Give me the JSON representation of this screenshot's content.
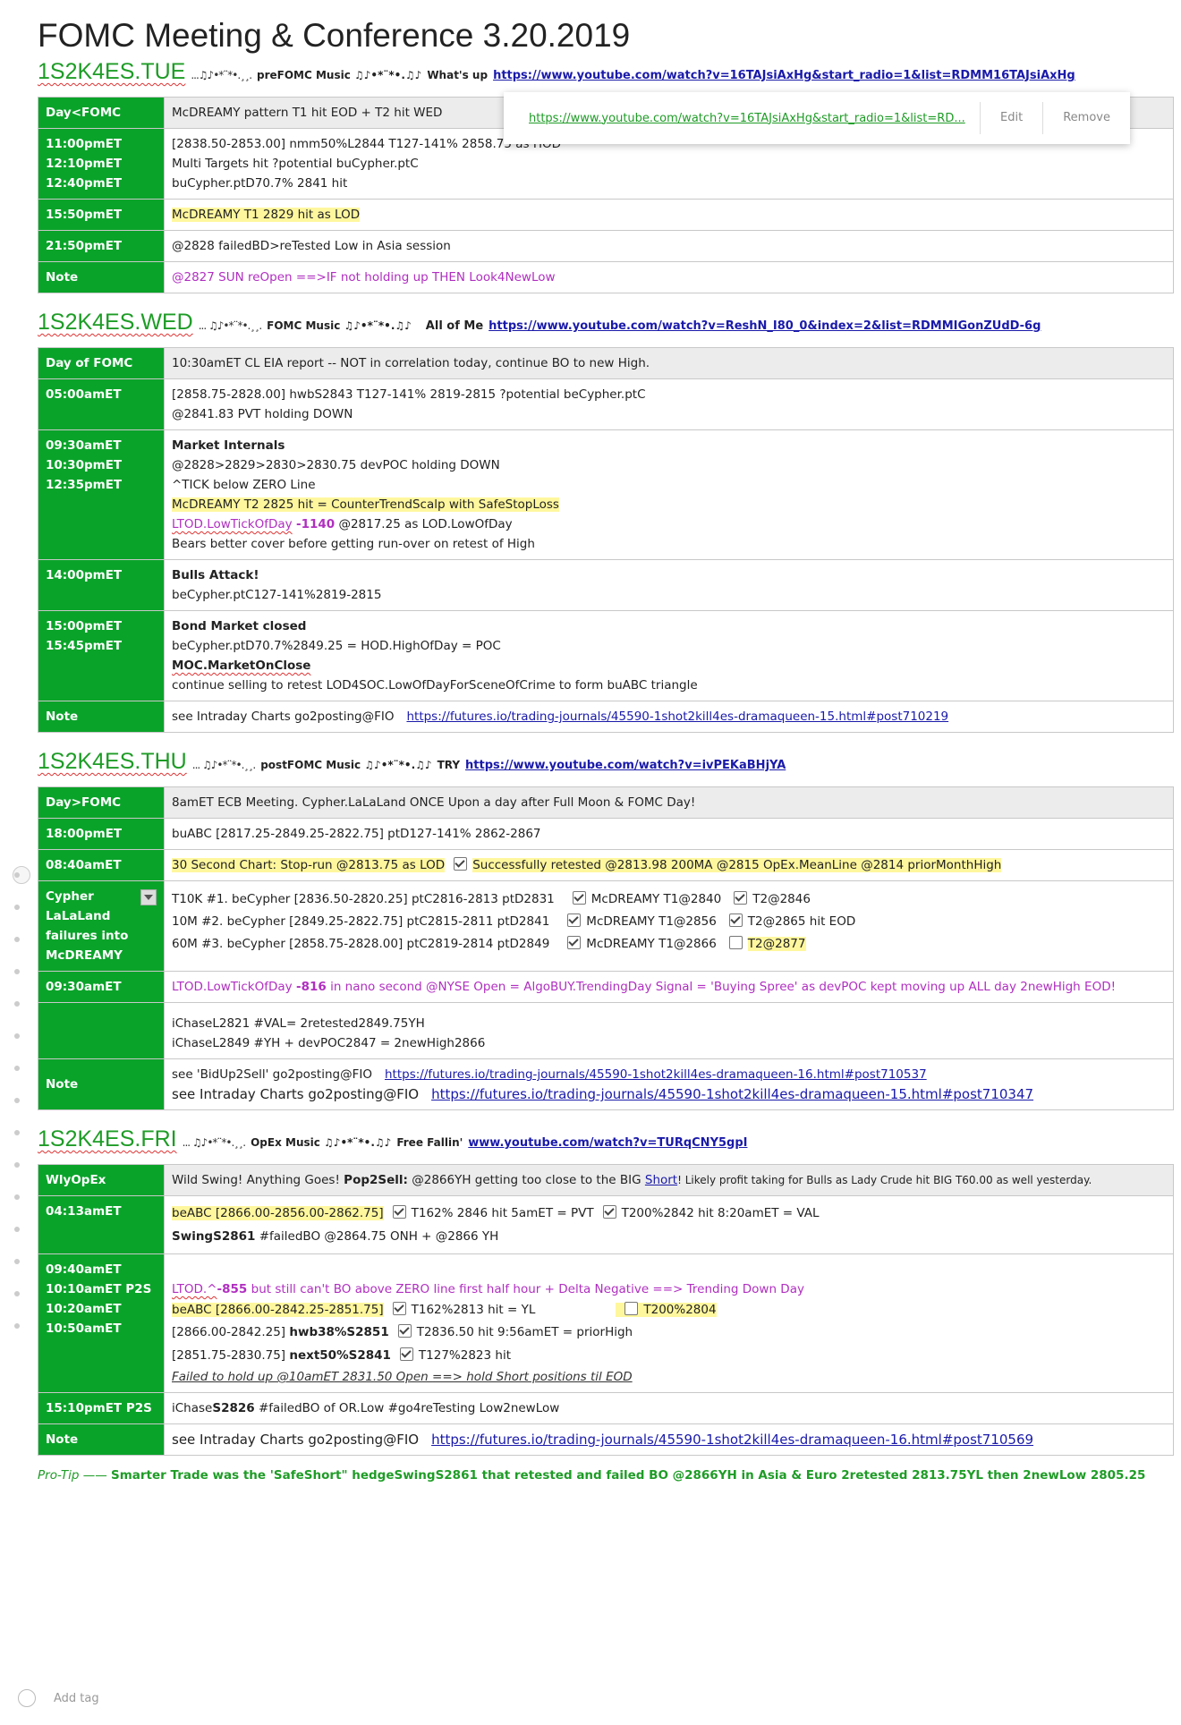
{
  "title": "FOMC Meeting & Conference 3.20.2019",
  "tue": {
    "heading": "1S2K4ES.TUE",
    "notes": "...♫♪•*¨*•.¸¸.",
    "label": "preFOMC Music ♫♪•*¨*•.♫♪",
    "label2": "What's up",
    "link": "https://www.youtube.com/watch?v=16TAJsiAxHg&start_radio=1&list=RDMM16TAJsiAxHg",
    "rows": {
      "r0_label": "Day<FOMC",
      "r0_c0": "McDREAMY pattern T1 hit EOD + T2 hit WED",
      "r1_l0": "11:00pmET",
      "r1_l1": "12:10pmET",
      "r1_l2": "12:40pmET",
      "r1_c0": "[2838.50-2853.00] nmm50%L2844 T127-141% 2858.75 as HOD",
      "r1_c1": "Multi Targets hit ?potential buCypher.ptC",
      "r1_c2": "buCypher.ptD70.7% 2841 hit",
      "r2_label": "15:50pmET",
      "r2_c0": "McDREAMY T1 2829 hit as LOD",
      "r3_label": "21:50pmET",
      "r3_c0": "@2828 failedBD>reTested Low in Asia session",
      "r4_label": "Note",
      "r4_c0": "@2827 SUN reOpen ==>IF not holding up THEN Look4NewLow"
    }
  },
  "popup": {
    "link": "https://www.youtube.com/watch?v=16TAJsiAxHg&start_radio=1&list=RD...",
    "edit": "Edit",
    "remove": "Remove"
  },
  "wed": {
    "heading": "1S2K4ES.WED",
    "notes": "... ♫♪•*¨*•.¸¸.",
    "label": "FOMC Music ♫♪•*¨*•.♫♪",
    "label2": "All of Me",
    "link": "https://www.youtube.com/watch?v=ReshN_I80_0&index=2&list=RDMMIGonZUdD-6g",
    "rows": {
      "r0_label": "Day of FOMC",
      "r0_c0": "10:30amET CL EIA report -- NOT in correlation today, continue BO to new High.",
      "r1_label": "05:00amET",
      "r1_c0": "[2858.75-2828.00] hwbS2843 T127-141% 2819-2815 ?potential beCypher.ptC",
      "r1_c1": "@2841.83 PVT holding DOWN",
      "r2_l0": "09:30amET",
      "r2_l3": "10:30pmET",
      "r2_l4": "12:35pmET",
      "r2_c0": "Market Internals",
      "r2_c1": "@2828>2829>2830>2830.75 devPOC holding DOWN",
      "r2_c2": "^TICK below ZERO Line",
      "r2_c3": "McDREAMY T2 2825 hit = CounterTrendScalp with SafeStopLoss",
      "r2_c4a": "LTOD.LowTickOfDay",
      "r2_c4b": "-1140",
      "r2_c4c": "@2817.25 as LOD.LowOfDay",
      "r2_c5": "Bears better cover before getting run-over on retest of High",
      "r3_label": "14:00pmET",
      "r3_c0": "Bulls Attack!",
      "r3_c1": "beCypher.ptC127-141%2819-2815",
      "r4_l0": "15:00pmET",
      "r4_l2": "15:45pmET",
      "r4_c0": "Bond Market closed",
      "r4_c1": "beCypher.ptD70.7%2849.25 = HOD.HighOfDay = POC",
      "r4_c2": "MOC.MarketOnClose",
      "r4_c3": "continue selling to retest LOD4SOC.LowOfDayForSceneOfCrime to form buABC triangle",
      "r5_label": "Note",
      "r5_c0": "see Intraday Charts go2posting@FIO",
      "r5_link": "https://futures.io/trading-journals/45590-1shot2kill4es-dramaqueen-15.html#post710219"
    }
  },
  "thu": {
    "heading": "1S2K4ES.THU",
    "notes": "... ♫♪•*¨*•.¸¸.",
    "label": "postFOMC Music ♫♪•*¨*•.♫♪",
    "label2": "TRY",
    "link": "https://www.youtube.com/watch?v=ivPEKaBHjYA",
    "rows": {
      "r0_label": "Day>FOMC",
      "r0_c0": "8amET ECB Meeting.  Cypher.LaLaLand ONCE Upon a day after Full Moon & FOMC Day!",
      "r1_label": "18:00pmET",
      "r1_c0": "buABC [2817.25-2849.25-2822.75] ptD127-141% 2862-2867",
      "r2_label": "08:40amET",
      "r2_c0a": "30 Second Chart:  Stop-run @2813.75 as LOD",
      "r2_c0b": "Successfully retested @2813.98 200MA @2815 OpEx.MeanLine @2814 priorMonthHigh",
      "r3_l0": "Cypher",
      "r3_l1": "LaLaLand",
      "r3_l2": "failures  into",
      "r3_l3": "McDREAMY",
      "r3_c0a": "T10K  #1.  beCypher [2836.50-2820.25] ptC2816-2813 ptD2831",
      "r3_c0b": "McDREAMY T1@2840",
      "r3_c0c": "T2@2846",
      "r3_c1a": "10M   #2.  beCypher [2849.25-2822.75] ptC2815-2811 ptD2841",
      "r3_c1b": "McDREAMY T1@2856",
      "r3_c1c": "T2@2865 hit EOD",
      "r3_c2a": "60M   #3.  beCypher [2858.75-2828.00] ptC2819-2814 ptD2849",
      "r3_c2b": "McDREAMY T1@2866",
      "r3_c2c": "T2@2877",
      "r4_label": "09:30amET",
      "r4_c0a": "LTOD.LowTickOfDay",
      "r4_c0b": "-816",
      "r4_c0c": "in nano second @NYSE Open = AlgoBUY.TrendingDay Signal = 'Buying Spree' as devPOC kept moving up ALL day 2newHigh EOD!",
      "r5_c0": "iChaseL2821 #VAL= 2retested2849.75YH",
      "r5_c1": "iChaseL2849 #YH + devPOC2847 = 2newHigh2866",
      "r6_label": "Note",
      "r6_c0": "see 'BidUp2Sell' go2posting@FIO",
      "r6_link0": "https://futures.io/trading-journals/45590-1shot2kill4es-dramaqueen-16.html#post710537",
      "r6_c1": "see Intraday Charts go2posting@FIO",
      "r6_link1": "https://futures.io/trading-journals/45590-1shot2kill4es-dramaqueen-15.html#post710347"
    }
  },
  "fri": {
    "heading": "1S2K4ES.FRI",
    "notes": "... ♫♪•*¨*•.¸¸.",
    "label": "OpEx Music ♫♪•*¨*•.♫♪",
    "label2": "Free Fallin'",
    "link": "www.youtube.com/watch?v=TURqCNY5gpI",
    "rows": {
      "r0_label": "WlyOpEx",
      "r0_c0a": "Wild Swing!  Anything Goes!",
      "r0_c0b": "Pop2Sell:",
      "r0_c0c": "@2866YH getting too close to the BIG",
      "r0_c0d": "Short",
      "r0_c0e": "! Likely profit taking for Bulls as Lady Crude hit BIG T60.00 as well yesterday.",
      "r1_label": "04:13amET",
      "r1_c0a": "beABC [2866.00-2856.00-2862.75]",
      "r1_c0b": "T162% 2846 hit 5amET = PVT",
      "r1_c0c": "T200%2842 hit 8:20amET = VAL",
      "r1_c1a": "SwingS2861",
      "r1_c1b": "#failedBO @2864.75 ONH + @2866 YH",
      "r2_l1": "09:40amET",
      "r2_l2": "10:10amET P2S",
      "r2_l5": "10:20amET",
      "r2_l6": "10:50amET",
      "r2_c0a": "LTOD.^",
      "r2_c0b": "-855",
      "r2_c0c": "but still can't BO above ZERO line first half hour + Delta Negative  ==> Trending Down Day",
      "r2_c1a": "beABC [2866.00-2842.25-2851.75]",
      "r2_c1b": "T162%2813 hit = YL",
      "r2_c1c": "T200%2804",
      "r2_c2a": "[2866.00-2842.25]",
      "r2_c2b": "hwb38%S2851",
      "r2_c2c": "T2836.50 hit 9:56amET = priorHigh",
      "r2_c3a": "[2851.75-2830.75]",
      "r2_c3b": "next50%S2841",
      "r2_c3c": "T127%2823 hit",
      "r2_c4": "Failed to hold up @10amET 2831.50 Open ==> hold Short positions til EOD",
      "r3_label": "15:10pmET P2S",
      "r3_c0a": "iChase",
      "r3_c0b": "S2826",
      "r3_c0c": "#failedBO of OR.Low #go4reTesting Low2newLow",
      "r4_label": "Note",
      "r4_c0": "see Intraday Charts go2posting@FIO",
      "r4_link": "https://futures.io/trading-journals/45590-1shot2kill4es-dramaqueen-16.html#post710569"
    }
  },
  "protip": {
    "label": "Pro-Tip ——",
    "text": "Smarter Trade was the 'SafeShort\" hedgeSwingS2861 that retested and failed BO @2866YH in Asia & Euro 2retested 2813.75YL then 2newLow 2805.25"
  },
  "addtag": "Add tag",
  "colors": {
    "green_label": "#0aa32a",
    "heading_green": "#1e9c26",
    "highlight": "#fff79e",
    "purple": "#b02fc0",
    "link": "#1a1aaa"
  }
}
